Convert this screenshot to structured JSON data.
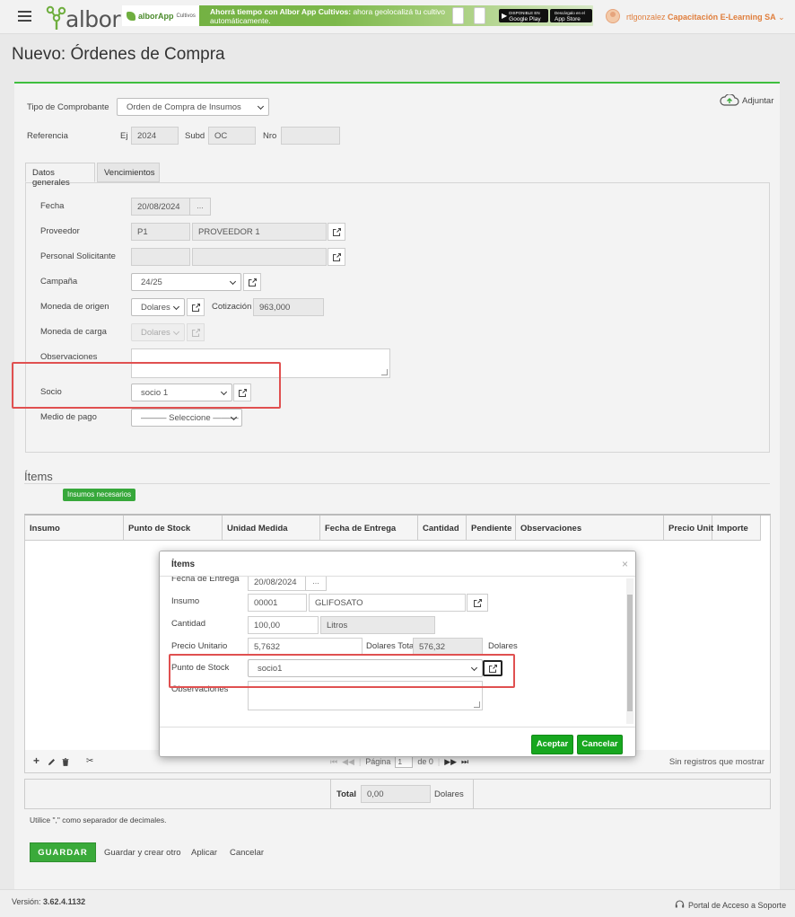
{
  "header": {
    "logo_text": "albor",
    "banner": {
      "brand": "alborApp",
      "brand_sub": "Cultivos",
      "headline": "Ahorrá tiempo con Albor App Cultivos:",
      "text": " ahora geolocalizá tu cultivo automáticamente.",
      "google_play_small": "DISPONIBLE EN",
      "google_play": "Google Play",
      "app_store_small": "Descárgalo en el",
      "app_store": "App Store"
    },
    "user": "rtlgonzalez",
    "company": "Capacitación E-Learning SA"
  },
  "page": {
    "title": "Nuevo: Órdenes de Compra"
  },
  "form": {
    "attach_label": "Adjuntar",
    "tipo_label": "Tipo de Comprobante",
    "tipo_value": "Orden de Compra de Insumos",
    "referencia_label": "Referencia",
    "ej_label": "Ej",
    "ej_value": "2024",
    "subd_label": "Subd",
    "subd_value": "OC",
    "nro_label": "Nro",
    "nro_value": "",
    "tabs": [
      "Datos generales",
      "Vencimientos"
    ],
    "fecha_label": "Fecha",
    "fecha_value": "20/08/2024",
    "dots": "...",
    "proveedor_label": "Proveedor",
    "proveedor_code": "P1",
    "proveedor_name": "PROVEEDOR 1",
    "personal_label": "Personal Solicitante",
    "campana_label": "Campaña",
    "campana_value": "24/25",
    "moneda_origen_label": "Moneda de origen",
    "moneda_origen_value": "Dolares",
    "cotizacion_label": "Cotización",
    "cotizacion_value": "963,000",
    "moneda_carga_label": "Moneda de carga",
    "moneda_carga_value": "Dolares",
    "observaciones_label": "Observaciones",
    "socio_label": "Socio",
    "socio_value": "socio 1",
    "medio_pago_label": "Medio de pago",
    "medio_pago_value": "——— Seleccione ———"
  },
  "items": {
    "title": "Ítems",
    "insumos_button": "Insumos necesarios",
    "columns": [
      "Insumo",
      "Punto de Stock",
      "Unidad Medida",
      "Fecha de Entrega",
      "Cantidad",
      "Pendiente",
      "Observaciones",
      "Precio Unit",
      "Importe"
    ],
    "pager_label": "Página",
    "page_value": "1",
    "page_of": "de 0",
    "no_records": "Sin registros que mostrar",
    "total_label": "Total",
    "total_value": "0,00",
    "total_currency": "Dolares"
  },
  "hint": "Utilice \",\" como separador de decimales.",
  "actions": {
    "save": "GUARDAR",
    "save_new": "Guardar y crear otro",
    "apply": "Aplicar",
    "cancel": "Cancelar"
  },
  "footer": {
    "version_label": "Versión:",
    "version": "3.62.4.1132",
    "support": "Portal de Acceso a Soporte"
  },
  "modal": {
    "title": "Ítems",
    "close": "×",
    "fecha_label": "Fecha de Entrega",
    "fecha_value": "20/08/2024",
    "insumo_label": "Insumo",
    "insumo_code": "00001",
    "insumo_name": "GLIFOSATO",
    "cantidad_label": "Cantidad",
    "cantidad_value": "100,00",
    "unidad": "Litros",
    "precio_label": "Precio Unitario",
    "precio_value": "5,7632",
    "total_label": "Dolares Total",
    "total_value": "576,32",
    "total_currency": "Dolares",
    "punto_label": "Punto de Stock",
    "punto_value": "socio1",
    "obs_label": "Observaciones",
    "accept": "Aceptar",
    "cancel": "Cancelar"
  },
  "colors": {
    "accent_green": "#3aaa3a",
    "highlight_red": "#e05050",
    "user_orange": "#e07e3c"
  }
}
